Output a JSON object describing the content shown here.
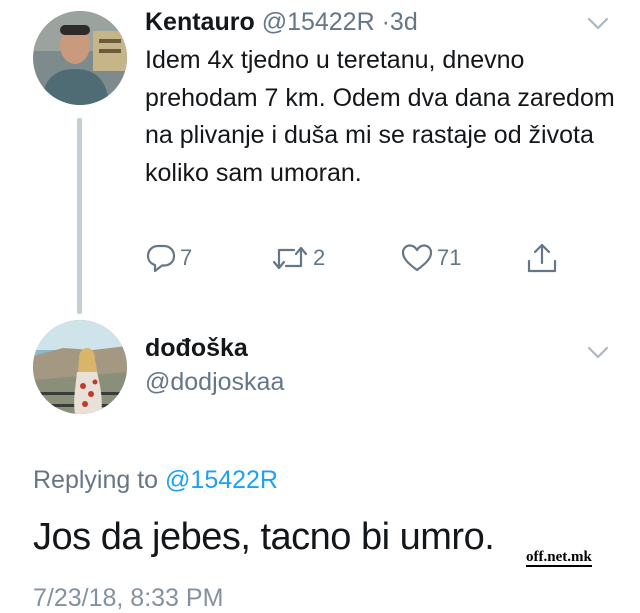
{
  "tweet1": {
    "name": "Kentauro",
    "handle": "@15422R",
    "separator": "·",
    "time": "3d",
    "body": "Idem 4x tjedno u teretanu, dnevno prehodam 7 km. Odem dva dana zaredom na plivanje i duša mi se rastaje od života koliko sam umoran.",
    "actions": {
      "replies": "7",
      "retweets": "2",
      "likes": "71"
    }
  },
  "tweet2": {
    "name": "dođoška",
    "handle": "@dodjoskaa",
    "replying_prefix": "Replying to",
    "replying_handle": "@15422R",
    "text": "Jos da jebes, tacno bi umro.",
    "timestamp": "7/23/18, 8:33 PM"
  },
  "watermark": "off.net.mk",
  "icons": [
    "chevron-down-icon",
    "reply-icon",
    "retweet-icon",
    "like-icon",
    "share-icon"
  ],
  "colors": {
    "text": "#14171a",
    "muted": "#657786",
    "link": "#1da1f2",
    "thread": "#c4cfd6"
  }
}
